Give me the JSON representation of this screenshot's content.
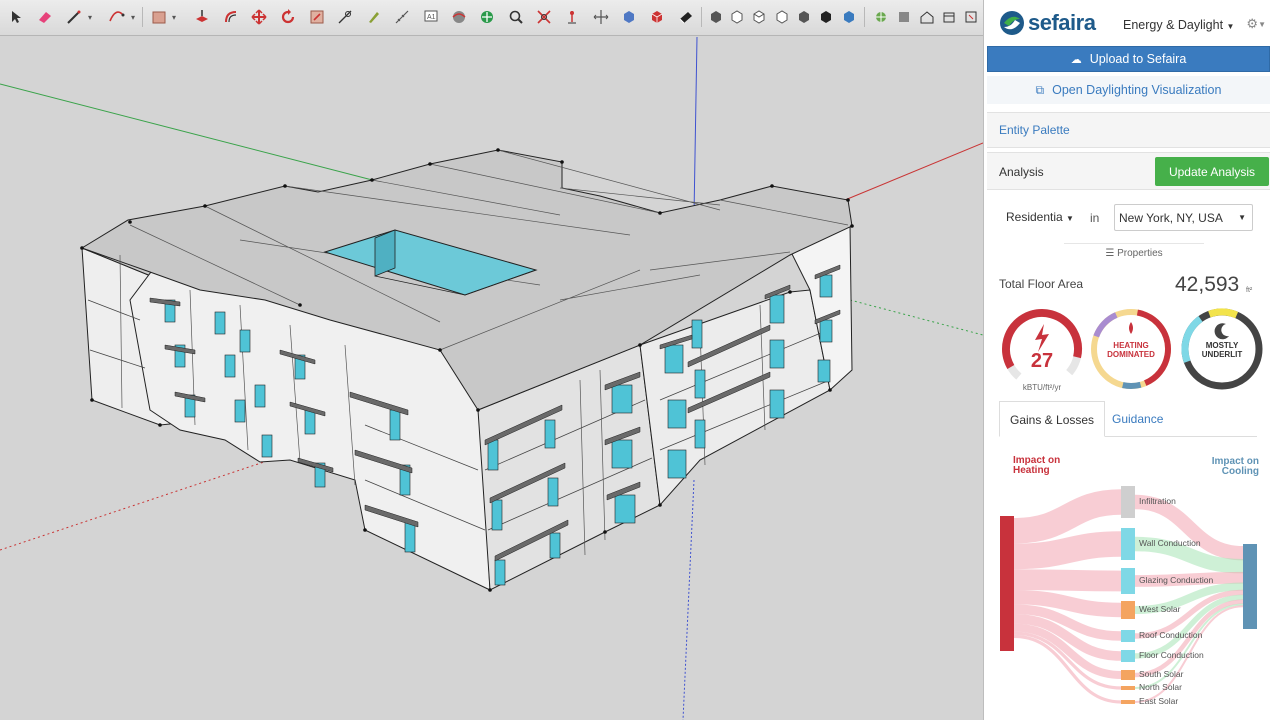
{
  "panel": {
    "logo_text": "sefaira",
    "mode": "Energy & Daylight",
    "upload_label": "Upload to Sefaira",
    "viz_label": "Open Daylighting Visualization",
    "entity_palette": "Entity Palette",
    "analysis_label": "Analysis",
    "update_label": "Update Analysis",
    "building_type": "Residentia",
    "in_label": "in",
    "location": "New York, NY, USA",
    "properties": "Properties",
    "floor_area_label": "Total Floor Area",
    "floor_area_value": "42,593",
    "floor_area_unit": "ft²",
    "eui_value": "27",
    "eui_unit": "kBTU/ft²/yr",
    "heating_badge": [
      "HEATING",
      "DOMINATED"
    ],
    "daylight_badge": [
      "MOSTLY",
      "UNDERLIT"
    ],
    "tabs": [
      "Gains & Losses",
      "Guidance"
    ],
    "impact_heating": [
      "Impact on",
      "Heating"
    ],
    "impact_cooling": [
      "Impact on",
      "Cooling"
    ],
    "sankey_items": [
      {
        "label": "Infiltration",
        "color": "#cfcfcf"
      },
      {
        "label": "Wall Conduction",
        "color": "#7fd8e6"
      },
      {
        "label": "Glazing Conduction",
        "color": "#7fd8e6"
      },
      {
        "label": "West Solar",
        "color": "#f4a460"
      },
      {
        "label": "Roof Conduction",
        "color": "#7fd8e6"
      },
      {
        "label": "Floor Conduction",
        "color": "#7fd8e6"
      },
      {
        "label": "South Solar",
        "color": "#f4a460"
      },
      {
        "label": "North Solar",
        "color": "#f4a460"
      },
      {
        "label": "East Solar",
        "color": "#f4a460"
      }
    ],
    "colors": {
      "heating": "#c8323c",
      "cooling": "#5f93b5",
      "brand": "#1e5a8a",
      "accent": "#3a7bbf",
      "update": "#46b04a"
    }
  },
  "toolbar": {
    "tools": [
      "select-icon",
      "eraser-icon",
      "line-icon",
      "arc-icon",
      "rectangle-icon",
      "push-pull-icon",
      "offset-icon",
      "move-icon",
      "rotate-icon",
      "scale-icon",
      "tape-measure-icon",
      "paint-icon",
      "text-icon",
      "orbit-icon",
      "pan-icon",
      "zoom-icon",
      "zoom-extents-icon",
      "position-camera-icon",
      "walk-icon",
      "section-plane-icon",
      "component-icon",
      "material-icon",
      "style-icon",
      "view-iso-icon",
      "view-top-icon",
      "view-front-icon",
      "view-right-icon",
      "view-back-icon",
      "view-left-icon",
      "view-bottom-icon",
      "geo-location-icon",
      "model-info-icon",
      "warehouse-icon",
      "extension-icon",
      "layout-icon"
    ]
  }
}
